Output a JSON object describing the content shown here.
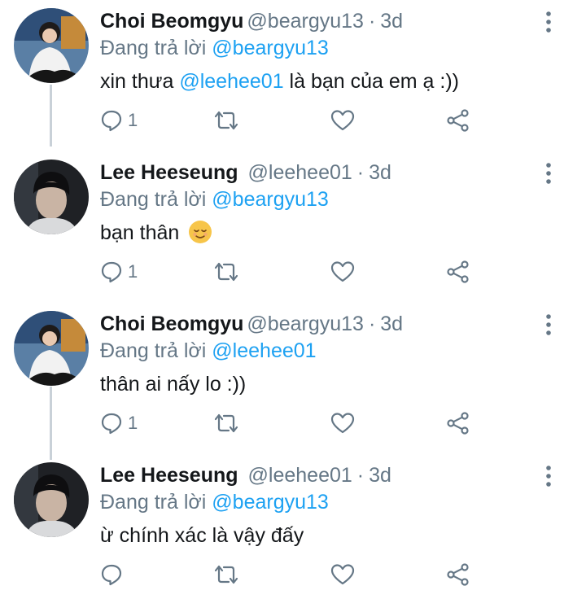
{
  "tweets": [
    {
      "name": "Choi Beomgyu",
      "handle": "@beargyu13",
      "dot": "·",
      "time": "3d",
      "reply_prefix": "Đang trả lời",
      "reply_mention": "@beargyu13",
      "text_before": "xin thưa ",
      "text_mention": "@leehee01",
      "text_after": " là bạn của em ạ :))",
      "reply_count": "1",
      "avatar": "avatar-beomgyu"
    },
    {
      "name": "Lee Heeseung",
      "handle": "@leehee01",
      "dot": "·",
      "time": "3d",
      "reply_prefix": "Đang trả lời",
      "reply_mention": "@beargyu13",
      "text": "bạn thân",
      "emoji": "relieved-face-emoji",
      "reply_count": "1",
      "avatar": "avatar-heeseung"
    },
    {
      "name": "Choi Beomgyu",
      "handle": "@beargyu13",
      "dot": "·",
      "time": "3d",
      "reply_prefix": "Đang trả lời",
      "reply_mention": "@leehee01",
      "text": "thân ai nấy lo :))",
      "reply_count": "1",
      "avatar": "avatar-beomgyu"
    },
    {
      "name": "Lee Heeseung",
      "handle": "@leehee01",
      "dot": "·",
      "time": "3d",
      "reply_prefix": "Đang trả lời",
      "reply_mention": "@beargyu13",
      "text": "ừ chính xác là vậy đấy",
      "reply_count": "",
      "avatar": "avatar-heeseung"
    }
  ],
  "icons": {
    "reply": "reply-icon",
    "retweet": "retweet-icon",
    "like": "heart-icon",
    "share": "share-icon",
    "more": "more-vertical-icon"
  },
  "colors": {
    "mention": "#1da1f2",
    "secondary_text": "#657786",
    "primary_text": "#14171a",
    "thread_line": "#c9d1d8"
  }
}
